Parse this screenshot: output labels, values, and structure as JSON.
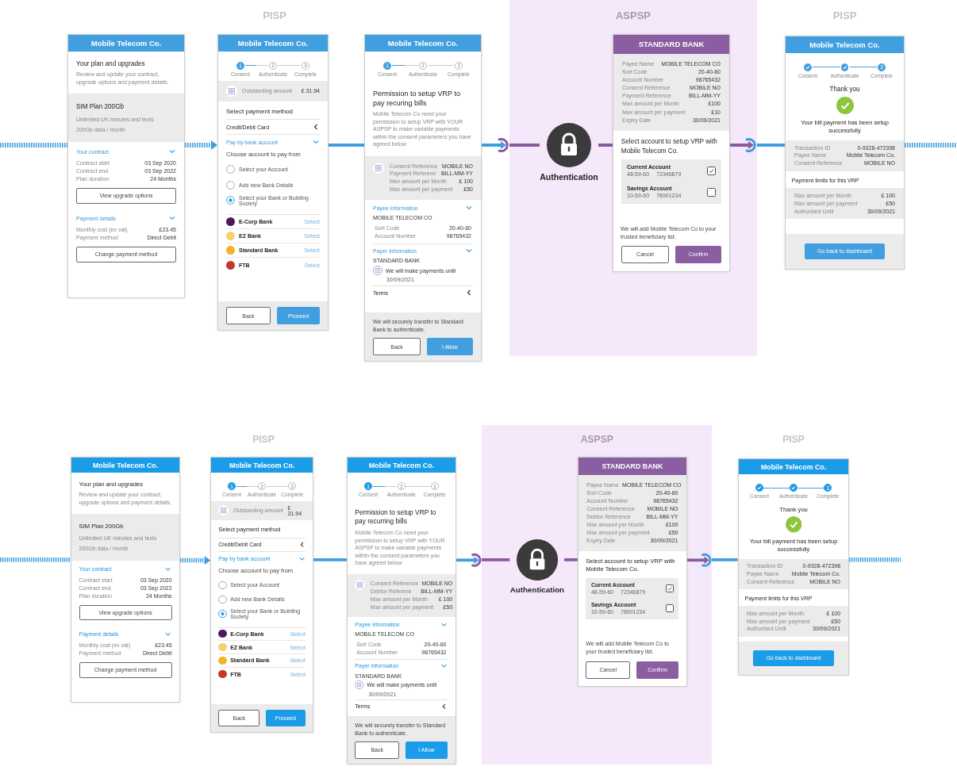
{
  "flows": [
    {
      "groups": [
        {
          "kind": "pisp",
          "label": "PISP",
          "screens": [
            {
              "kind": "plan",
              "header": "Mobile Telecom Co.",
              "title": "Your plan and upgrades",
              "description": "Review and update your contract, upgrade options and payment details.",
              "plan": {
                "name": "SIM Plan 200Gb",
                "lines": [
                  "Unlimited UK minutes and texts",
                  "200Gb data / month"
                ]
              },
              "sections": [
                {
                  "title": "Your contract",
                  "expanded": true,
                  "rows": [
                    {
                      "label": "Contract start",
                      "value": "03 Sep 2020"
                    },
                    {
                      "label": "Contract end",
                      "value": "03 Sep 2022"
                    },
                    {
                      "label": "Plan duration",
                      "value": "24 Months"
                    }
                  ],
                  "button": "View upgrade options"
                },
                {
                  "title": "Payment details",
                  "expanded": true,
                  "rows": [
                    {
                      "label": "Monthly cost (ex vat)",
                      "value": "£23.45"
                    },
                    {
                      "label": "Payment method",
                      "value": "Direct Debit"
                    }
                  ],
                  "button": "Change payment method"
                }
              ]
            },
            {
              "kind": "payment",
              "header": "Mobile Telecom Co.",
              "steps": [
                {
                  "label": "Consent",
                  "done": false,
                  "current": true,
                  "number": "1"
                },
                {
                  "label": "Authenticate",
                  "done": false,
                  "current": false,
                  "number": "2"
                },
                {
                  "label": "Complete",
                  "done": false,
                  "current": false,
                  "number": "3"
                }
              ],
              "amount": {
                "label": "Outstanding amount",
                "value": "£ 31.94"
              },
              "heading": "Select payment method",
              "methods": [
                {
                  "label": "Credit/Debit Card",
                  "expanded": false
                },
                {
                  "label": "Pay by bank account",
                  "expanded": true
                }
              ],
              "subheading": "Choose account to pay from",
              "choices": [
                {
                  "label": "Select your Account",
                  "selected": false
                },
                {
                  "label": "Add new Bank Details",
                  "selected": false
                },
                {
                  "label": "Select your Bank or Building Society",
                  "selected": true
                }
              ],
              "banks": [
                {
                  "name": "E-Corp Bank",
                  "action": "Select",
                  "color": "#4b1a5e"
                },
                {
                  "name": "EZ Bank",
                  "action": "Select",
                  "color": "#f2d36e"
                },
                {
                  "name": "Standard Bank",
                  "action": "Select",
                  "color": "#f0b429"
                },
                {
                  "name": "FTB",
                  "action": "Select",
                  "color": "#c8342f"
                }
              ],
              "buttons": [
                {
                  "label": "Back",
                  "kind": "secondary"
                },
                {
                  "label": "Proceed",
                  "kind": "primary"
                }
              ]
            },
            {
              "kind": "consent",
              "header": "Mobile Telecom Co.",
              "steps": [
                {
                  "label": "Consent",
                  "done": false,
                  "current": true,
                  "number": "1"
                },
                {
                  "label": "Authenticate",
                  "done": false,
                  "current": false,
                  "number": "2"
                },
                {
                  "label": "Complete",
                  "done": false,
                  "current": false,
                  "number": "3"
                }
              ],
              "title": "Permission to setup VRP to pay recuring bills",
              "description": "Mobile Telecom Co need your permission to setup VRP with YOUR ASPSP to make variable payments within the consent parameters you have agreed below",
              "summary": [
                {
                  "label": "Consent Reference",
                  "value": "MOBILE NO"
                },
                {
                  "label": "Payment Referene",
                  "value": "BILL-MM-YY"
                },
                {
                  "label": "Max amount per Month",
                  "value": "£ 100"
                },
                {
                  "label": "Max amount per payment",
                  "value": "£50"
                }
              ],
              "payee": {
                "title": "Payee information",
                "expanded": true,
                "name": "MOBILE TELECOM CO",
                "rows": [
                  {
                    "label": "Sort Code",
                    "value": "20-40-60"
                  },
                  {
                    "label": "Account Number",
                    "value": "98765432"
                  }
                ]
              },
              "payer": {
                "title": "Payer information",
                "expanded": true,
                "name": "STANDARD BANK",
                "note": "We will make payments until",
                "date": "30/09/2021"
              },
              "terms": {
                "title": "Terms",
                "expanded": false
              },
              "footer": "We will securely transfer to Standard Bank to authenticate.",
              "buttons": [
                {
                  "label": "Back",
                  "kind": "secondary"
                },
                {
                  "label": "I Allow",
                  "kind": "primary"
                }
              ]
            }
          ]
        },
        {
          "kind": "aspsp",
          "label": "ASPSP",
          "auth_label": "Authentication",
          "screens": [
            {
              "kind": "bank",
              "header": "STANDARD BANK",
              "details": [
                {
                  "label": "Payee Name",
                  "value": "MOBILE TELECOM CO"
                },
                {
                  "label": "Sort Code",
                  "value": "20-40-60"
                },
                {
                  "label": "Account Number",
                  "value": "98765432"
                },
                {
                  "label": "Consent Reference",
                  "value": "MOBILE NO"
                },
                {
                  "label": "Payment Reference",
                  "value": "BILL-MM-YY"
                },
                {
                  "label": "Max amount per Month",
                  "value": "£100"
                },
                {
                  "label": "Max amount per payment",
                  "value": "£10"
                },
                {
                  "label": "Expiry Date",
                  "value": "30/09/2021"
                }
              ],
              "heading": "Select account to setup VRP with Mobile Telecom Co.",
              "accounts": [
                {
                  "name": "Current Account",
                  "sort_code": "48-59-60",
                  "number": "72346879",
                  "checked": true
                },
                {
                  "name": "Savings Account",
                  "sort_code": "10-59-60",
                  "number": "78901234",
                  "checked": false
                }
              ],
              "note": "We will add Mobile Telecom Co to your trusted beneficiary list.",
              "buttons": [
                {
                  "label": "Cancel",
                  "kind": "secondary"
                },
                {
                  "label": "Confirm",
                  "kind": "primary"
                }
              ]
            }
          ]
        },
        {
          "kind": "pisp",
          "label": "PISP",
          "screens": [
            {
              "kind": "done",
              "header": "Mobile Telecom Co.",
              "steps": [
                {
                  "label": "Consent",
                  "done": true,
                  "current": false
                },
                {
                  "label": "Authenticate",
                  "done": true,
                  "current": false
                },
                {
                  "label": "Complete",
                  "done": false,
                  "current": true,
                  "number": "3"
                }
              ],
              "title": "Thank you",
              "message": "Your bill payment has been setup successfully",
              "details": [
                {
                  "label": "Transaction ID",
                  "value": "0-9328-472398"
                },
                {
                  "label": "Payee Name",
                  "value": "Mobile Telecom Co."
                },
                {
                  "label": "Consent Reference",
                  "value": "MOBILE NO"
                }
              ],
              "limits_title": "Payment limits for this VRP",
              "limits": [
                {
                  "label": "Max amount per Month",
                  "value": "£ 100"
                },
                {
                  "label": "Max amount per payment",
                  "value": "£50"
                },
                {
                  "label": "Authorised Until",
                  "value": "30/09/2021"
                }
              ],
              "button": "Go back to dashboard"
            }
          ]
        }
      ]
    },
    {
      "groups": [
        {
          "kind": "pisp",
          "label": "PISP",
          "screens": [
            {
              "kind": "plan",
              "header": "Mobile Telecom Co.",
              "title": "Your plan and upgrades",
              "description": "Review and update your contract, upgrade options and payment details.",
              "plan": {
                "name": "SIM Plan 200Gb",
                "lines": [
                  "Unlimited UK minutes and texts",
                  "200Gb data / month"
                ]
              },
              "sections": [
                {
                  "title": "Your contract",
                  "expanded": true,
                  "rows": [
                    {
                      "label": "Contract start",
                      "value": "03 Sep 2020"
                    },
                    {
                      "label": "Contract end",
                      "value": "03 Sep 2022"
                    },
                    {
                      "label": "Plan duration",
                      "value": "24 Months"
                    }
                  ],
                  "button": "View upgrade options"
                },
                {
                  "title": "Payment details",
                  "expanded": true,
                  "rows": [
                    {
                      "label": "Monthly cost (ex vat)",
                      "value": "£23.45"
                    },
                    {
                      "label": "Payment method",
                      "value": "Direct Debit"
                    }
                  ],
                  "button": "Change payment method"
                }
              ]
            },
            {
              "kind": "payment",
              "header": "Mobile Telecom Co.",
              "steps": [
                {
                  "label": "Consent",
                  "done": false,
                  "current": true,
                  "number": "1"
                },
                {
                  "label": "Authenticate",
                  "done": false,
                  "current": false,
                  "number": "2"
                },
                {
                  "label": "Complete",
                  "done": false,
                  "current": false,
                  "number": "3"
                }
              ],
              "amount": {
                "label": "Outstanding amount",
                "value": "£ 31.94"
              },
              "heading": "Select payment method",
              "methods": [
                {
                  "label": "Credit/Debit Card",
                  "expanded": false
                },
                {
                  "label": "Pay by bank account",
                  "expanded": true
                }
              ],
              "subheading": "Choose account to pay from",
              "choices": [
                {
                  "label": "Select your Account",
                  "selected": false
                },
                {
                  "label": "Add new Bank Details",
                  "selected": false
                },
                {
                  "label": "Select your Bank or Building Society",
                  "selected": true
                }
              ],
              "banks": [
                {
                  "name": "E-Corp Bank",
                  "action": "Select",
                  "color": "#4b1a5e"
                },
                {
                  "name": "EZ Bank",
                  "action": "Select",
                  "color": "#f2d36e"
                },
                {
                  "name": "Standard Bank",
                  "action": "Select",
                  "color": "#f0b429"
                },
                {
                  "name": "FTB",
                  "action": "Select",
                  "color": "#c8342f"
                }
              ],
              "buttons": [
                {
                  "label": "Back",
                  "kind": "secondary"
                },
                {
                  "label": "Proceed",
                  "kind": "primary"
                }
              ]
            },
            {
              "kind": "consent",
              "header": "Mobile Telecom Co.",
              "steps": [
                {
                  "label": "Consent",
                  "done": false,
                  "current": true,
                  "number": "1"
                },
                {
                  "label": "Authenticate",
                  "done": false,
                  "current": false,
                  "number": "2"
                },
                {
                  "label": "Complete",
                  "done": false,
                  "current": false,
                  "number": "3"
                }
              ],
              "title": "Permission to setup VRP to pay recurring bills",
              "description": "Mobile Telecom Co need your permission to setup VRP with YOUR ASPSP to make variable payments within the consent parameters you have agreed below",
              "summary": [
                {
                  "label": "Consent Reference",
                  "value": "MOBILE NO"
                },
                {
                  "label": "Debtor Referene",
                  "value": "BILL-MM-YY"
                },
                {
                  "label": "Max amount per Month",
                  "value": "£ 100"
                },
                {
                  "label": "Max amount per payment",
                  "value": "£50"
                }
              ],
              "payee": {
                "title": "Payee information",
                "expanded": true,
                "name": "MOBILE TELECOM CO",
                "rows": [
                  {
                    "label": "Sort Code",
                    "value": "20-40-60"
                  },
                  {
                    "label": "Account Number",
                    "value": "98765432"
                  }
                ]
              },
              "payer": {
                "title": "Payer information",
                "expanded": true,
                "name": "STANDARD BANK",
                "note": "We will make payments until",
                "date": "30/09/2021"
              },
              "terms": {
                "title": "Terms",
                "expanded": false
              },
              "footer": "We will securely transfer to Standard Bank to authenticate.",
              "buttons": [
                {
                  "label": "Back",
                  "kind": "secondary"
                },
                {
                  "label": "I Allow",
                  "kind": "primary"
                }
              ]
            }
          ]
        },
        {
          "kind": "aspsp",
          "label": "ASPSP",
          "auth_label": "Authentication",
          "screens": [
            {
              "kind": "bank",
              "header": "STANDARD BANK",
              "details": [
                {
                  "label": "Payee Name",
                  "value": "MOBILE TELECOM CO"
                },
                {
                  "label": "Sort Code",
                  "value": "20-40-60"
                },
                {
                  "label": "Account Number",
                  "value": "98765432"
                },
                {
                  "label": "Consent Reference",
                  "value": "MOBILE NO"
                },
                {
                  "label": "Debtor Reference",
                  "value": "BILL-MM-YY"
                },
                {
                  "label": "Max amount per Month",
                  "value": "£100"
                },
                {
                  "label": "Max amount per payment",
                  "value": "£50"
                },
                {
                  "label": "Expiry Date",
                  "value": "30/09/2021"
                }
              ],
              "heading": "Select account to setup VRP with Mobile Telecom Co.",
              "accounts": [
                {
                  "name": "Current Account",
                  "sort_code": "48-59-60",
                  "number": "72346879",
                  "checked": true
                },
                {
                  "name": "Savings Account",
                  "sort_code": "10-59-60",
                  "number": "78901234",
                  "checked": false
                }
              ],
              "note": "We will add Mobile Telecom Co to your trusted beneficiary list.",
              "buttons": [
                {
                  "label": "Cancel",
                  "kind": "secondary"
                },
                {
                  "label": "Confirm",
                  "kind": "primary"
                }
              ]
            }
          ]
        },
        {
          "kind": "pisp",
          "label": "PISP",
          "screens": [
            {
              "kind": "done",
              "header": "Mobile Telecom Co.",
              "steps": [
                {
                  "label": "Consent",
                  "done": true,
                  "current": false
                },
                {
                  "label": "Authenticate",
                  "done": true,
                  "current": false
                },
                {
                  "label": "Complete",
                  "done": false,
                  "current": true,
                  "number": "3"
                }
              ],
              "title": "Thank you",
              "message": "Your bill payment has been setup successfully",
              "details": [
                {
                  "label": "Transaction ID",
                  "value": "0-9328-472398"
                },
                {
                  "label": "Payee Name",
                  "value": "Mobile Telecom Co."
                },
                {
                  "label": "Consent Reference",
                  "value": "MOBILE NO"
                }
              ],
              "limits_title": "Payment limits for this VRP",
              "limits": [
                {
                  "label": "Max amount per Month",
                  "value": "£ 100"
                },
                {
                  "label": "Max amount per payment",
                  "value": "£50"
                },
                {
                  "label": "Authorised Until",
                  "value": "30/09/2021"
                }
              ],
              "button": "Go back to dashboard"
            }
          ]
        }
      ]
    }
  ]
}
